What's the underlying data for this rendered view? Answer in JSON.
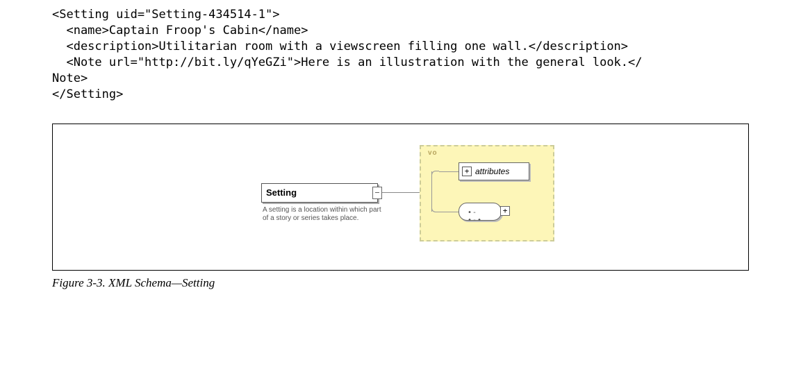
{
  "code": {
    "line1": "<Setting uid=\"Setting-434514-1\">",
    "line2": "  <name>Captain Froop's Cabin</name>",
    "line3": "  <description>Utilitarian room with a viewscreen filling one wall.</description>",
    "line4": "  <Note url=\"http://bit.ly/qYeGZi\">Here is an illustration with the general look.</",
    "line5": "Note>",
    "line6": "</Setting>"
  },
  "diagram": {
    "element_label": "Setting",
    "element_desc": "A setting is a location within which part of a story or series takes place.",
    "group_label": "vo",
    "attributes_label": "attributes",
    "plus": "+",
    "sequence_glyph": "•-•-•"
  },
  "caption": "Figure 3-3. XML Schema—Setting"
}
